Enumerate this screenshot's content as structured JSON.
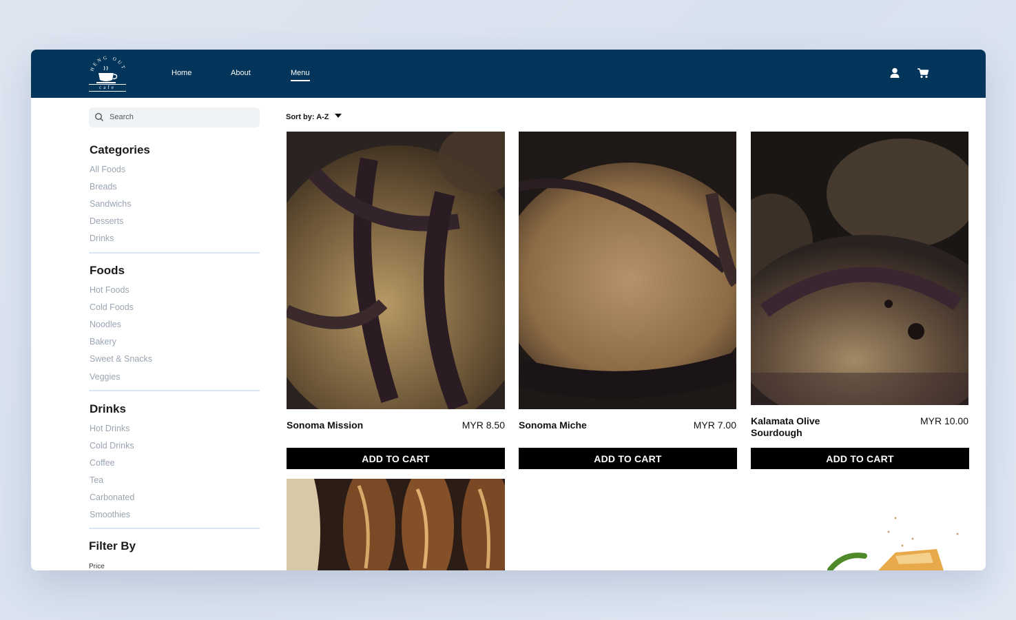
{
  "brand": {
    "logo_text_top": "HENG OUT",
    "logo_text_bottom": "cafe"
  },
  "nav": {
    "items": [
      "Home",
      "About",
      "Menu"
    ],
    "active": "Menu"
  },
  "icons": {
    "user": "user-icon",
    "cart": "cart-icon",
    "search": "search-icon",
    "sort": "caret-down-icon"
  },
  "search": {
    "placeholder": "Search"
  },
  "sidebar": {
    "categories": {
      "title": "Categories",
      "items": [
        "All Foods",
        "Breads",
        "Sandwichs",
        "Desserts",
        "Drinks"
      ]
    },
    "foods": {
      "title": "Foods",
      "items": [
        "Hot Foods",
        "Cold Foods",
        "Noodles",
        "Bakery",
        "Sweet & Snacks",
        "Veggies"
      ]
    },
    "drinks": {
      "title": "Drinks",
      "items": [
        "Hot Drinks",
        "Cold Drinks",
        "Coffee",
        "Tea",
        "Carbonated",
        "Smoothies"
      ]
    },
    "filter": {
      "title": "Filter By",
      "price_label": "Price"
    }
  },
  "sort": {
    "label": "Sort by: A-Z"
  },
  "products": [
    {
      "name": "Sonoma Mission",
      "price": "MYR 8.50",
      "button": "ADD TO CART"
    },
    {
      "name": "Sonoma Miche",
      "price": "MYR 7.00",
      "button": "ADD TO CART"
    },
    {
      "name": "Kalamata Olive Sourdough",
      "price": "MYR 10.00",
      "button": "ADD TO CART"
    }
  ],
  "colors": {
    "navbar": "#03355a",
    "muted_text": "#9aa5b1",
    "button": "#000000",
    "divider": "#dbe6f2"
  }
}
